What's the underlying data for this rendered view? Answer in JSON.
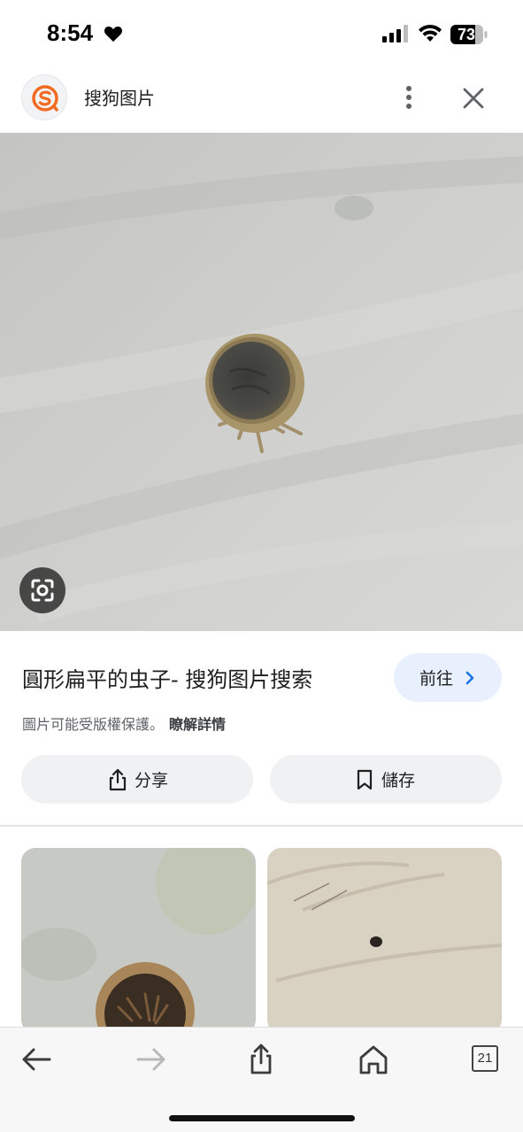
{
  "status_bar": {
    "time": "8:54",
    "battery_level": "73"
  },
  "header": {
    "site_name": "搜狗图片",
    "logo_icon": "sogou-logo-icon",
    "brand_color": "#f26a21"
  },
  "result": {
    "title": "圓形扁平的虫子- 搜狗图片搜索",
    "goto_label": "前往",
    "copyright_text": "圖片可能受版權保護。",
    "copyright_link": "瞭解詳情",
    "share_label": "分享",
    "save_label": "儲存"
  },
  "toolbar": {
    "tabs_count": "21"
  },
  "colors": {
    "accent_button_bg": "#e8f0fe",
    "accent_blue": "#1a73e8",
    "neutral_button_bg": "#f0f1f3"
  }
}
